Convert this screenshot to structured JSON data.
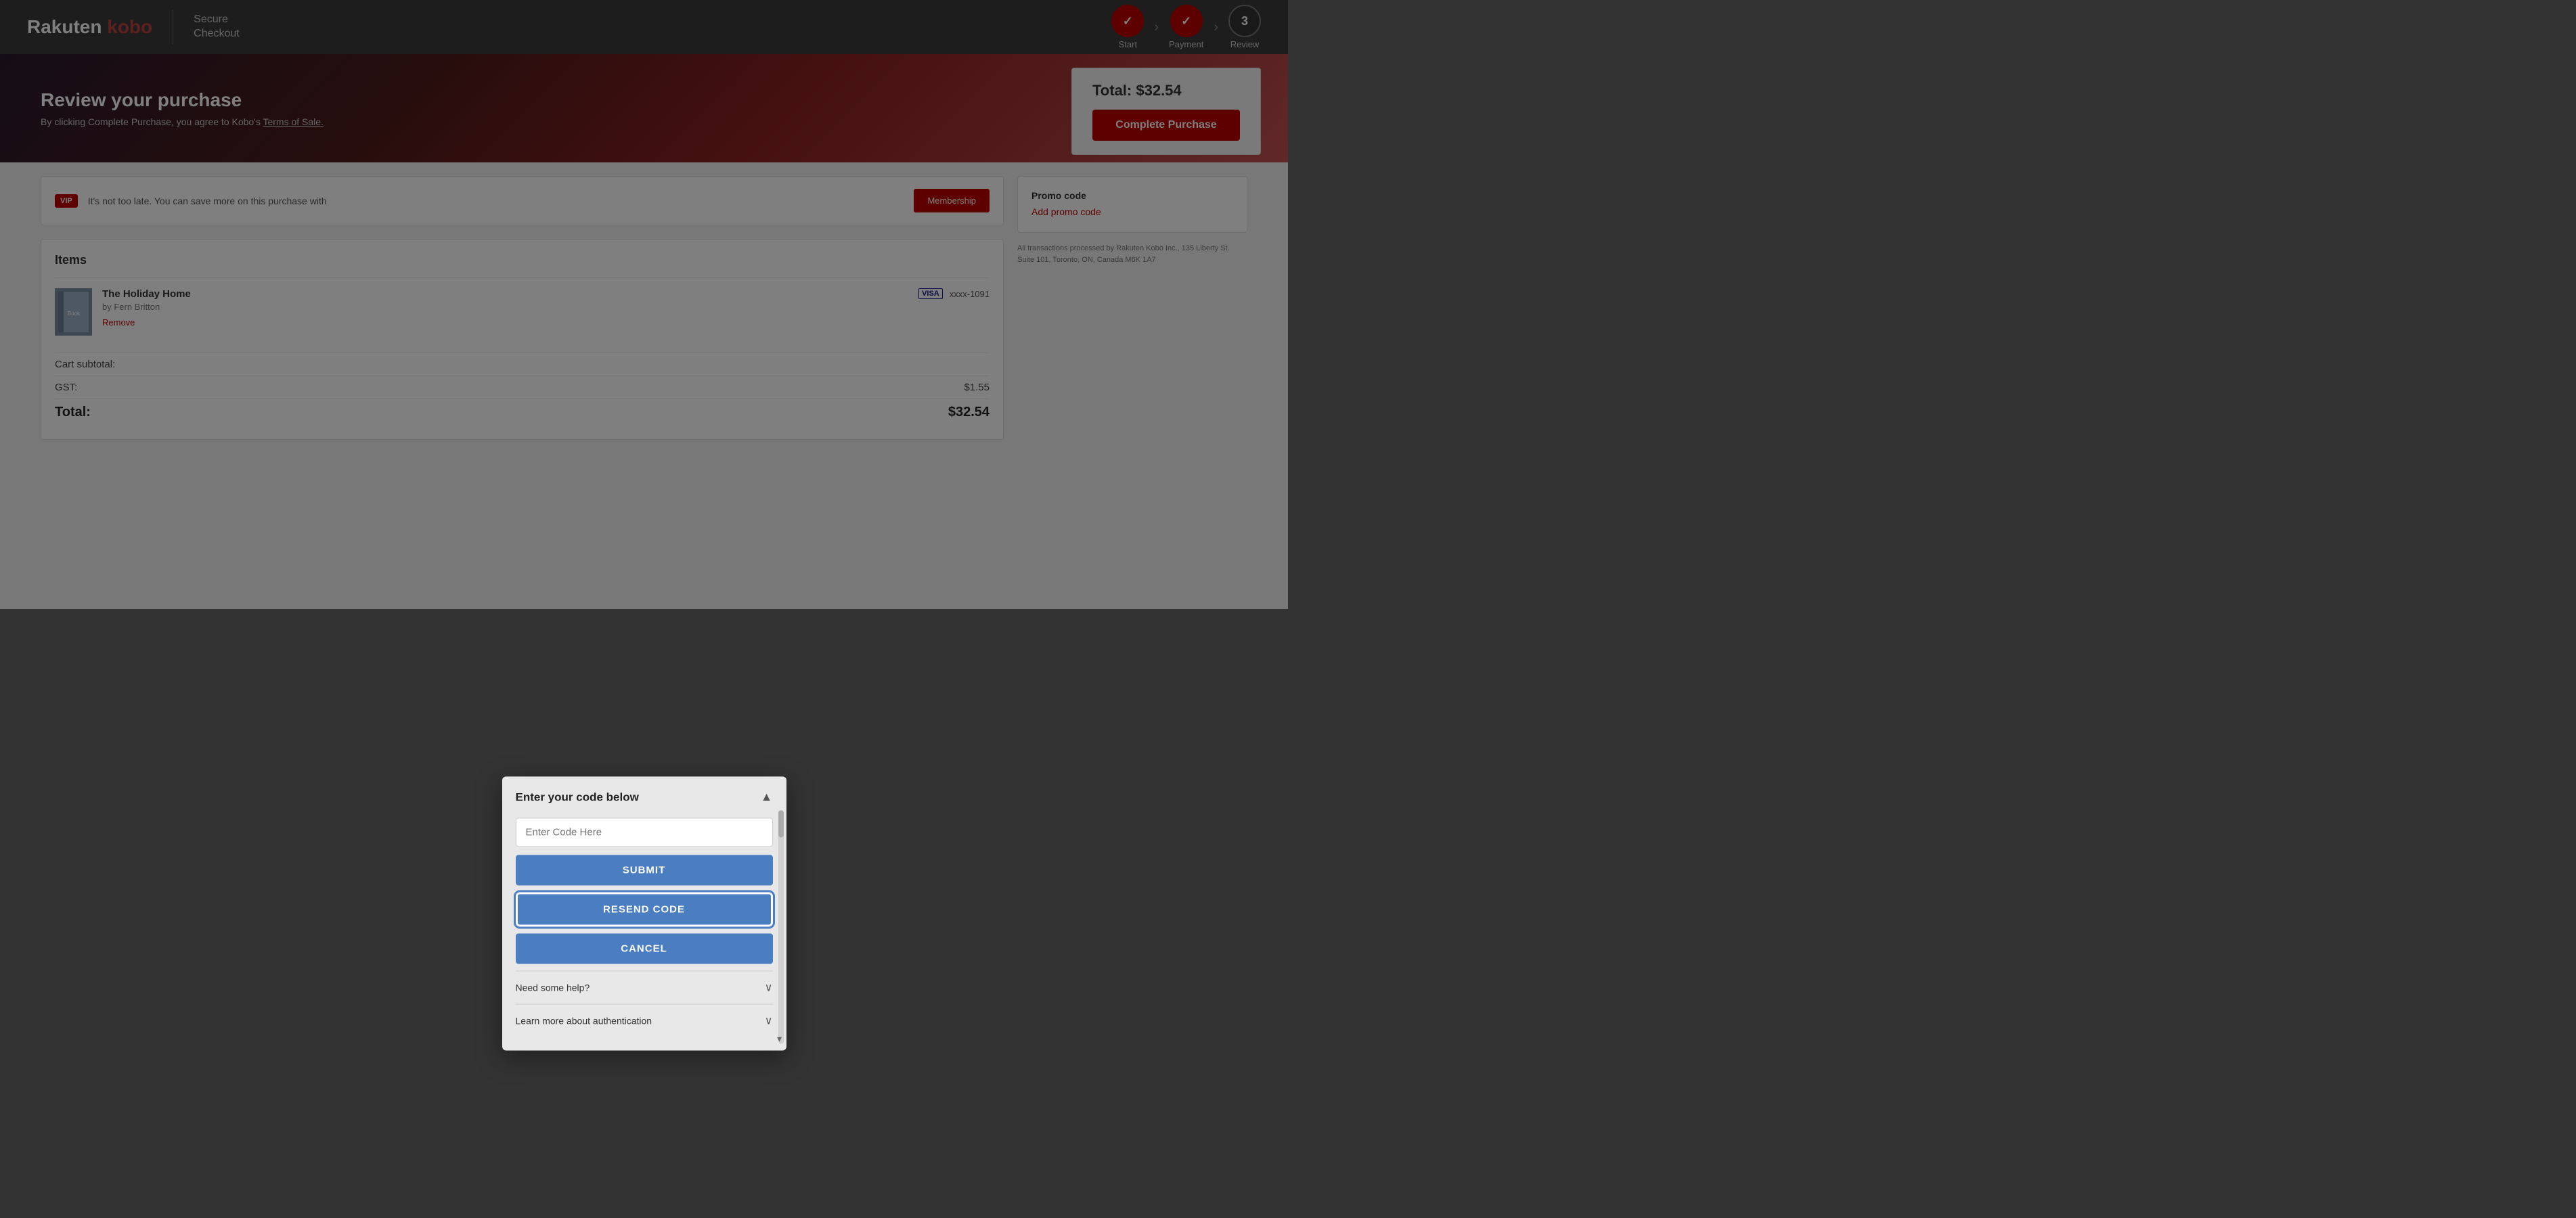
{
  "header": {
    "logo_text": "Rakuten kobo",
    "secure_checkout": "Secure\nCheckout",
    "steps": [
      {
        "label": "Start",
        "state": "done",
        "icon": "✓"
      },
      {
        "label": "Payment",
        "state": "done",
        "icon": "✓"
      },
      {
        "label": "Review",
        "state": "current",
        "icon": "3"
      }
    ]
  },
  "hero": {
    "title": "Review your purchase",
    "subtitle": "By clicking Complete Purchase, you agree to Kobo's Terms of Sale.",
    "total_label": "Total: $32.54",
    "complete_btn": "Complete Purchase"
  },
  "vip": {
    "badge": "VIP",
    "text": "It's not too late. You can save more on this purchase with",
    "link_label": "Membership"
  },
  "items": {
    "section_title": "Items",
    "list": [
      {
        "title": "The Holiday Home",
        "author": "by Fern Britton",
        "remove_label": "Remove",
        "card_type": "VISA",
        "card_num": "xxxx-1091"
      }
    ]
  },
  "totals": {
    "subtotal_label": "Cart subtotal:",
    "gst_label": "GST:",
    "gst_value": "$1.55",
    "total_label": "Total:",
    "total_value": "$32.54"
  },
  "promo": {
    "label": "Promo code",
    "link": "Add promo code"
  },
  "legal": {
    "text": "All transactions processed by Rakuten Kobo Inc., 135 Liberty St. Suite 101, Toronto, ON, Canada M6K 1A7"
  },
  "modal": {
    "title": "Enter your code below",
    "input_placeholder": "Enter Code Here",
    "submit_label": "SUBMIT",
    "resend_label": "RESEND CODE",
    "cancel_label": "CANCEL",
    "help_label": "Need some help?",
    "auth_label": "Learn more about authentication"
  }
}
